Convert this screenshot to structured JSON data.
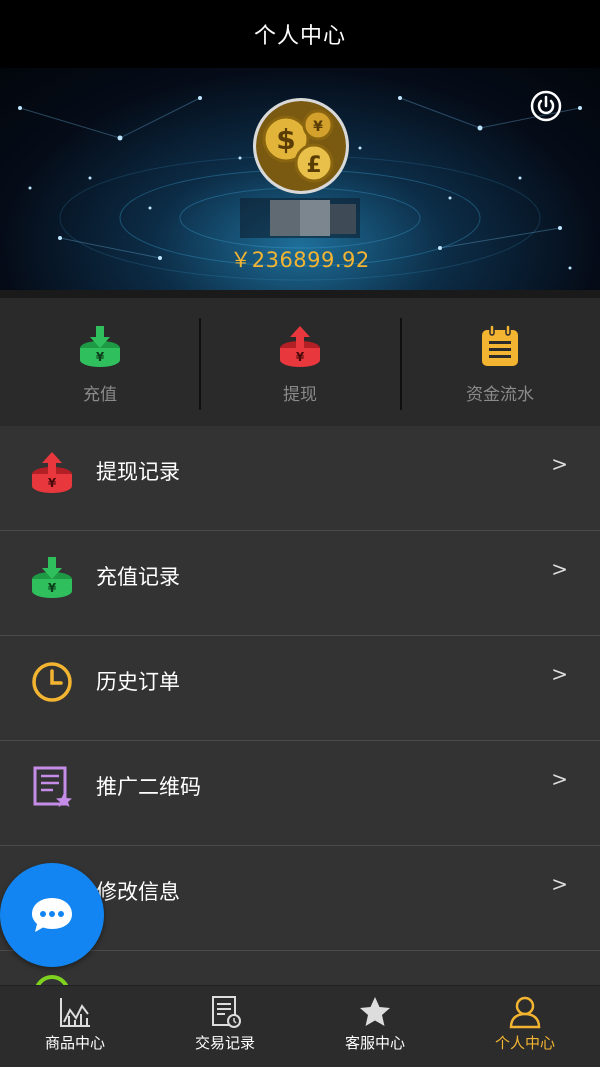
{
  "header": {
    "title": "个人中心"
  },
  "profile": {
    "balance": "￥236899.92"
  },
  "quick_actions": [
    {
      "label": "充值",
      "icon": "recharge-icon"
    },
    {
      "label": "提现",
      "icon": "withdraw-icon"
    },
    {
      "label": "资金流水",
      "icon": "clipboard-icon"
    }
  ],
  "menu": [
    {
      "label": "提现记录",
      "icon": "withdraw-icon",
      "arrow": ">"
    },
    {
      "label": "充值记录",
      "icon": "recharge-icon",
      "arrow": ">"
    },
    {
      "label": "历史订单",
      "icon": "clock-icon",
      "arrow": ">"
    },
    {
      "label": "推广二维码",
      "icon": "certificate-icon",
      "arrow": ">"
    },
    {
      "label": "修改信息",
      "icon": "edit-icon",
      "arrow": ">"
    }
  ],
  "tabs": [
    {
      "label": "商品中心",
      "icon": "chart-icon"
    },
    {
      "label": "交易记录",
      "icon": "record-icon"
    },
    {
      "label": "客服中心",
      "icon": "star-icon"
    },
    {
      "label": "个人中心",
      "icon": "user-icon",
      "active": true
    }
  ],
  "colors": {
    "accent": "#f3b531",
    "green": "#2fbf5c",
    "red": "#e8383d",
    "purple": "#c58ce8",
    "chat": "#1285f2"
  }
}
